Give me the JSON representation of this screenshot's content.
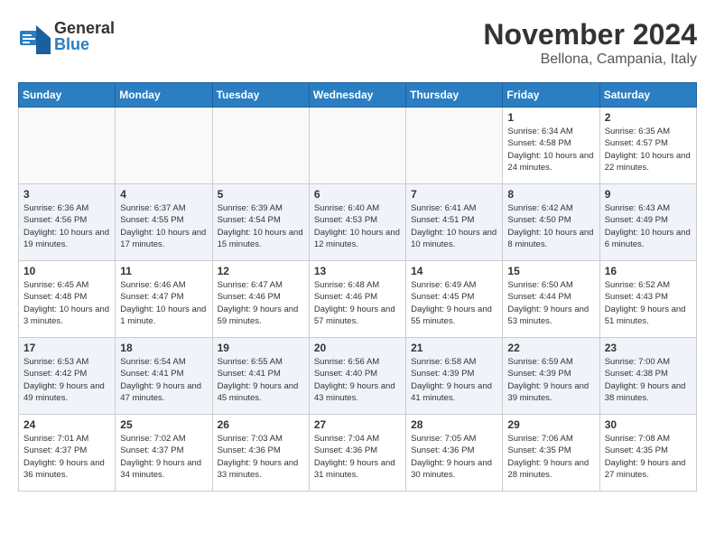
{
  "header": {
    "logo_general": "General",
    "logo_blue": "Blue",
    "month_title": "November 2024",
    "subtitle": "Bellona, Campania, Italy"
  },
  "calendar": {
    "weekdays": [
      "Sunday",
      "Monday",
      "Tuesday",
      "Wednesday",
      "Thursday",
      "Friday",
      "Saturday"
    ],
    "weeks": [
      [
        {
          "day": "",
          "info": ""
        },
        {
          "day": "",
          "info": ""
        },
        {
          "day": "",
          "info": ""
        },
        {
          "day": "",
          "info": ""
        },
        {
          "day": "",
          "info": ""
        },
        {
          "day": "1",
          "info": "Sunrise: 6:34 AM\nSunset: 4:58 PM\nDaylight: 10 hours and 24 minutes."
        },
        {
          "day": "2",
          "info": "Sunrise: 6:35 AM\nSunset: 4:57 PM\nDaylight: 10 hours and 22 minutes."
        }
      ],
      [
        {
          "day": "3",
          "info": "Sunrise: 6:36 AM\nSunset: 4:56 PM\nDaylight: 10 hours and 19 minutes."
        },
        {
          "day": "4",
          "info": "Sunrise: 6:37 AM\nSunset: 4:55 PM\nDaylight: 10 hours and 17 minutes."
        },
        {
          "day": "5",
          "info": "Sunrise: 6:39 AM\nSunset: 4:54 PM\nDaylight: 10 hours and 15 minutes."
        },
        {
          "day": "6",
          "info": "Sunrise: 6:40 AM\nSunset: 4:53 PM\nDaylight: 10 hours and 12 minutes."
        },
        {
          "day": "7",
          "info": "Sunrise: 6:41 AM\nSunset: 4:51 PM\nDaylight: 10 hours and 10 minutes."
        },
        {
          "day": "8",
          "info": "Sunrise: 6:42 AM\nSunset: 4:50 PM\nDaylight: 10 hours and 8 minutes."
        },
        {
          "day": "9",
          "info": "Sunrise: 6:43 AM\nSunset: 4:49 PM\nDaylight: 10 hours and 6 minutes."
        }
      ],
      [
        {
          "day": "10",
          "info": "Sunrise: 6:45 AM\nSunset: 4:48 PM\nDaylight: 10 hours and 3 minutes."
        },
        {
          "day": "11",
          "info": "Sunrise: 6:46 AM\nSunset: 4:47 PM\nDaylight: 10 hours and 1 minute."
        },
        {
          "day": "12",
          "info": "Sunrise: 6:47 AM\nSunset: 4:46 PM\nDaylight: 9 hours and 59 minutes."
        },
        {
          "day": "13",
          "info": "Sunrise: 6:48 AM\nSunset: 4:46 PM\nDaylight: 9 hours and 57 minutes."
        },
        {
          "day": "14",
          "info": "Sunrise: 6:49 AM\nSunset: 4:45 PM\nDaylight: 9 hours and 55 minutes."
        },
        {
          "day": "15",
          "info": "Sunrise: 6:50 AM\nSunset: 4:44 PM\nDaylight: 9 hours and 53 minutes."
        },
        {
          "day": "16",
          "info": "Sunrise: 6:52 AM\nSunset: 4:43 PM\nDaylight: 9 hours and 51 minutes."
        }
      ],
      [
        {
          "day": "17",
          "info": "Sunrise: 6:53 AM\nSunset: 4:42 PM\nDaylight: 9 hours and 49 minutes."
        },
        {
          "day": "18",
          "info": "Sunrise: 6:54 AM\nSunset: 4:41 PM\nDaylight: 9 hours and 47 minutes."
        },
        {
          "day": "19",
          "info": "Sunrise: 6:55 AM\nSunset: 4:41 PM\nDaylight: 9 hours and 45 minutes."
        },
        {
          "day": "20",
          "info": "Sunrise: 6:56 AM\nSunset: 4:40 PM\nDaylight: 9 hours and 43 minutes."
        },
        {
          "day": "21",
          "info": "Sunrise: 6:58 AM\nSunset: 4:39 PM\nDaylight: 9 hours and 41 minutes."
        },
        {
          "day": "22",
          "info": "Sunrise: 6:59 AM\nSunset: 4:39 PM\nDaylight: 9 hours and 39 minutes."
        },
        {
          "day": "23",
          "info": "Sunrise: 7:00 AM\nSunset: 4:38 PM\nDaylight: 9 hours and 38 minutes."
        }
      ],
      [
        {
          "day": "24",
          "info": "Sunrise: 7:01 AM\nSunset: 4:37 PM\nDaylight: 9 hours and 36 minutes."
        },
        {
          "day": "25",
          "info": "Sunrise: 7:02 AM\nSunset: 4:37 PM\nDaylight: 9 hours and 34 minutes."
        },
        {
          "day": "26",
          "info": "Sunrise: 7:03 AM\nSunset: 4:36 PM\nDaylight: 9 hours and 33 minutes."
        },
        {
          "day": "27",
          "info": "Sunrise: 7:04 AM\nSunset: 4:36 PM\nDaylight: 9 hours and 31 minutes."
        },
        {
          "day": "28",
          "info": "Sunrise: 7:05 AM\nSunset: 4:36 PM\nDaylight: 9 hours and 30 minutes."
        },
        {
          "day": "29",
          "info": "Sunrise: 7:06 AM\nSunset: 4:35 PM\nDaylight: 9 hours and 28 minutes."
        },
        {
          "day": "30",
          "info": "Sunrise: 7:08 AM\nSunset: 4:35 PM\nDaylight: 9 hours and 27 minutes."
        }
      ]
    ]
  }
}
